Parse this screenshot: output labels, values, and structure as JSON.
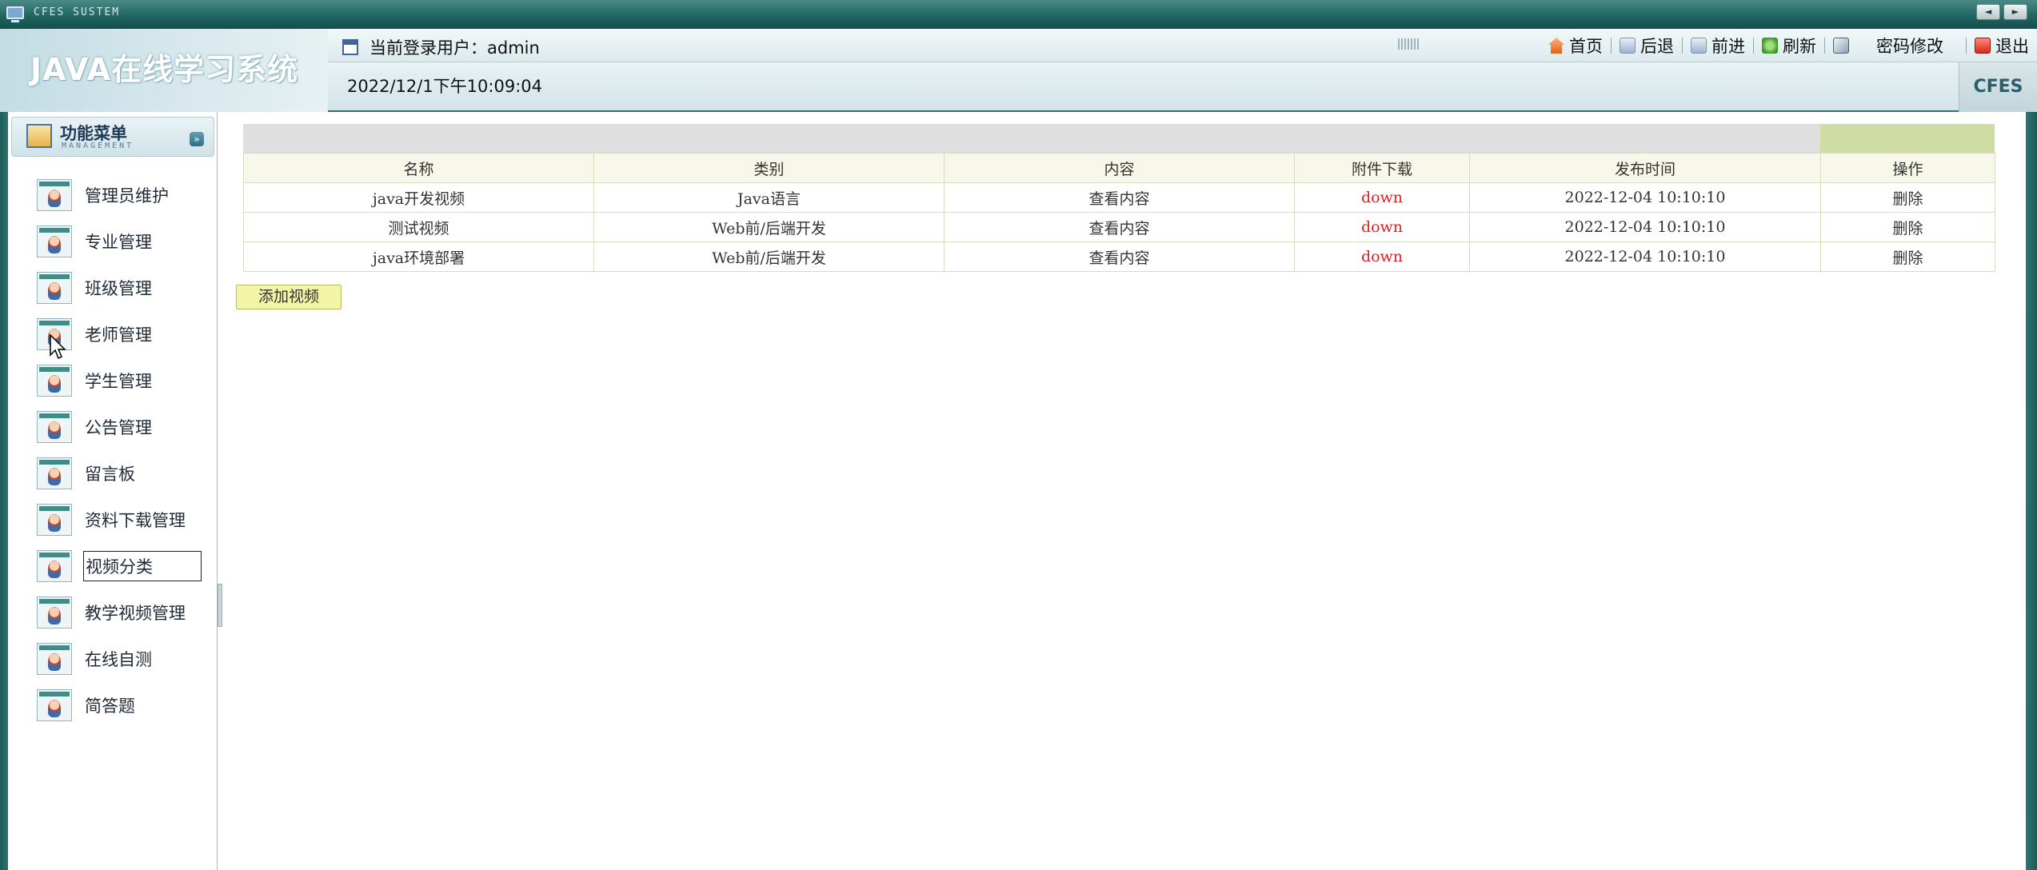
{
  "window": {
    "system_label": "CFES SUSTEM",
    "prev_label": "◄",
    "next_label": "►"
  },
  "header": {
    "logo_text": "JAVA在线学习系统",
    "user_text": "当前登录用户：admin",
    "datetime": "2022/12/1下午10:09:04",
    "brand_tag": "CFES",
    "links": {
      "home": "首页",
      "back": "后退",
      "forward": "前进",
      "refresh": "刷新",
      "password": "密码修改",
      "logout": "退出"
    }
  },
  "sidebar": {
    "title": "功能菜单",
    "subtitle": "MANAGEMENT",
    "collapse_label": "»",
    "items": [
      {
        "label": "管理员维护"
      },
      {
        "label": "专业管理"
      },
      {
        "label": "班级管理"
      },
      {
        "label": "老师管理"
      },
      {
        "label": "学生管理"
      },
      {
        "label": "公告管理"
      },
      {
        "label": "留言板"
      },
      {
        "label": "资料下载管理"
      },
      {
        "label": "视频分类"
      },
      {
        "label": "教学视频管理"
      },
      {
        "label": "在线自测"
      },
      {
        "label": "简答题"
      }
    ]
  },
  "table": {
    "columns": [
      "名称",
      "类别",
      "内容",
      "附件下载",
      "发布时间",
      "操作"
    ],
    "rows": [
      {
        "name": "java开发视频",
        "category": "Java语言",
        "content": "查看内容",
        "attachment": "down",
        "time": "2022-12-04 10:10:10",
        "action": "删除"
      },
      {
        "name": "测试视频",
        "category": "Web前/后端开发",
        "content": "查看内容",
        "attachment": "down",
        "time": "2022-12-04 10:10:10",
        "action": "删除"
      },
      {
        "name": "java环境部署",
        "category": "Web前/后端开发",
        "content": "查看内容",
        "attachment": "down",
        "time": "2022-12-04 10:10:10",
        "action": "删除"
      }
    ]
  },
  "add_button_label": "添加视频",
  "colors": {
    "frame": "#1f6461",
    "header_bg": "#dceaee",
    "toolbar_gray": "#dfdfdf",
    "toolbar_green": "#cfdca4",
    "table_header_bg": "#f7f8ea",
    "down_link": "#e02020",
    "add_button_bg": "#f2f4a6"
  }
}
